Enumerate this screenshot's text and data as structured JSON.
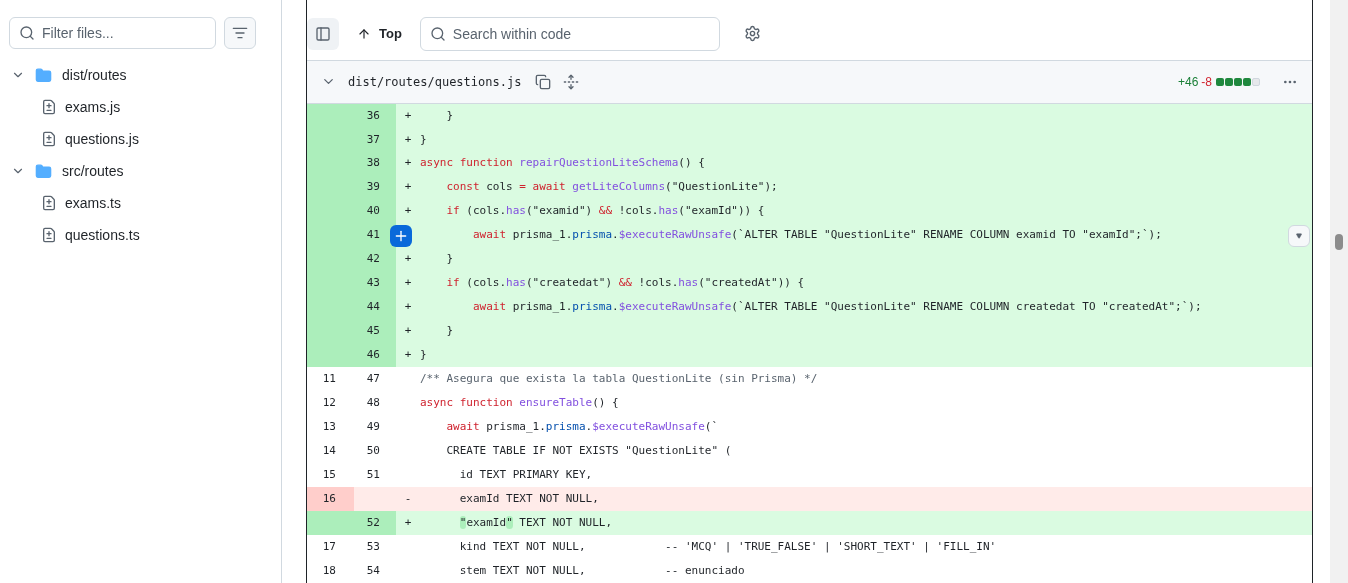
{
  "sidebar": {
    "filter": {
      "placeholder": "Filter files..."
    },
    "tree": [
      {
        "name": "dist/routes",
        "expanded": true,
        "children": [
          {
            "name": "exams.js"
          },
          {
            "name": "questions.js"
          }
        ]
      },
      {
        "name": "src/routes",
        "expanded": true,
        "children": [
          {
            "name": "exams.ts"
          },
          {
            "name": "questions.ts"
          }
        ]
      }
    ]
  },
  "toolbar": {
    "top_label": "Top",
    "search": {
      "placeholder": "Search within code"
    }
  },
  "file": {
    "path": "dist/routes/questions.js",
    "expanded": true,
    "additions": "+46",
    "deletions": "-8",
    "diffstat": [
      {
        "kind": "add"
      },
      {
        "kind": "add"
      },
      {
        "kind": "add"
      },
      {
        "kind": "add"
      },
      {
        "kind": "neutral"
      }
    ],
    "lines": [
      {
        "kind": "add",
        "new": "36",
        "marker": "+",
        "tokens": [
          {
            "kind": "plain",
            "t": "    }"
          }
        ]
      },
      {
        "kind": "add",
        "new": "37",
        "marker": "+",
        "tokens": [
          {
            "kind": "plain",
            "t": "}"
          }
        ]
      },
      {
        "kind": "add",
        "new": "38",
        "marker": "+",
        "tokens": [
          {
            "kind": "keyword",
            "t": "async function"
          },
          {
            "kind": "function",
            "t": " repairQuestionLiteSchema"
          },
          {
            "kind": "plain",
            "t": "() {"
          }
        ]
      },
      {
        "kind": "add",
        "new": "39",
        "marker": "+",
        "tokens": [
          {
            "kind": "keyword",
            "t": "    const"
          },
          {
            "kind": "plain",
            "t": " cols "
          },
          {
            "kind": "keyword",
            "t": "= await"
          },
          {
            "kind": "function",
            "t": " getLiteColumns"
          },
          {
            "kind": "plain",
            "t": "(\"QuestionLite\");"
          }
        ]
      },
      {
        "kind": "add",
        "new": "40",
        "marker": "+",
        "tokens": [
          {
            "kind": "keyword",
            "t": "    if"
          },
          {
            "kind": "plain",
            "t": " (cols."
          },
          {
            "kind": "function",
            "t": "has"
          },
          {
            "kind": "plain",
            "t": "(\"examid\") "
          },
          {
            "kind": "keyword",
            "t": "&&"
          },
          {
            "kind": "plain",
            "t": " !cols."
          },
          {
            "kind": "function",
            "t": "has"
          },
          {
            "kind": "plain",
            "t": "(\"examId\")) {"
          }
        ]
      },
      {
        "kind": "add",
        "new": "41",
        "hovered": true,
        "tokens": [
          {
            "kind": "keyword",
            "t": "        await"
          },
          {
            "kind": "plain",
            "t": " prisma_1."
          },
          {
            "kind": "property",
            "t": "prisma"
          },
          {
            "kind": "plain",
            "t": "."
          },
          {
            "kind": "function",
            "t": "$executeRawUnsafe"
          },
          {
            "kind": "plain",
            "t": "(`ALTER TABLE \"QuestionLite\" RENAME COLUMN examid TO \"examId\";`);"
          }
        ]
      },
      {
        "kind": "add",
        "new": "42",
        "marker": "+",
        "tokens": [
          {
            "kind": "plain",
            "t": "    }"
          }
        ]
      },
      {
        "kind": "add",
        "new": "43",
        "marker": "+",
        "tokens": [
          {
            "kind": "keyword",
            "t": "    if"
          },
          {
            "kind": "plain",
            "t": " (cols."
          },
          {
            "kind": "function",
            "t": "has"
          },
          {
            "kind": "plain",
            "t": "(\"createdat\") "
          },
          {
            "kind": "keyword",
            "t": "&&"
          },
          {
            "kind": "plain",
            "t": " !cols."
          },
          {
            "kind": "function",
            "t": "has"
          },
          {
            "kind": "plain",
            "t": "(\"createdAt\")) {"
          }
        ]
      },
      {
        "kind": "add",
        "new": "44",
        "marker": "+",
        "tokens": [
          {
            "kind": "keyword",
            "t": "        await"
          },
          {
            "kind": "plain",
            "t": " prisma_1."
          },
          {
            "kind": "property",
            "t": "prisma"
          },
          {
            "kind": "plain",
            "t": "."
          },
          {
            "kind": "function",
            "t": "$executeRawUnsafe"
          },
          {
            "kind": "plain",
            "t": "(`ALTER TABLE \"QuestionLite\" RENAME COLUMN createdat TO \"createdAt\";`);"
          }
        ]
      },
      {
        "kind": "add",
        "new": "45",
        "marker": "+",
        "tokens": [
          {
            "kind": "plain",
            "t": "    }"
          }
        ]
      },
      {
        "kind": "add",
        "new": "46",
        "marker": "+",
        "tokens": [
          {
            "kind": "plain",
            "t": "}"
          }
        ]
      },
      {
        "kind": "ctx",
        "old": "11",
        "new": "47",
        "tokens": [
          {
            "kind": "comment",
            "t": "/** Asegura que exista la tabla QuestionLite (sin Prisma) */"
          }
        ]
      },
      {
        "kind": "ctx",
        "old": "12",
        "new": "48",
        "tokens": [
          {
            "kind": "keyword",
            "t": "async function"
          },
          {
            "kind": "function",
            "t": " ensureTable"
          },
          {
            "kind": "plain",
            "t": "() {"
          }
        ]
      },
      {
        "kind": "ctx",
        "old": "13",
        "new": "49",
        "tokens": [
          {
            "kind": "keyword",
            "t": "    await"
          },
          {
            "kind": "plain",
            "t": " prisma_1."
          },
          {
            "kind": "property",
            "t": "prisma"
          },
          {
            "kind": "plain",
            "t": "."
          },
          {
            "kind": "function",
            "t": "$executeRawUnsafe"
          },
          {
            "kind": "plain",
            "t": "(`"
          }
        ]
      },
      {
        "kind": "ctx",
        "old": "14",
        "new": "50",
        "tokens": [
          {
            "kind": "plain",
            "t": "    CREATE TABLE IF NOT EXISTS \"QuestionLite\" ("
          }
        ]
      },
      {
        "kind": "ctx",
        "old": "15",
        "new": "51",
        "tokens": [
          {
            "kind": "plain",
            "t": "      id TEXT PRIMARY KEY,"
          }
        ]
      },
      {
        "kind": "del",
        "old": "16",
        "marker": "-",
        "tokens": [
          {
            "kind": "plain",
            "t": "      examId TEXT NOT NULL,"
          }
        ]
      },
      {
        "kind": "add",
        "new": "52",
        "marker": "+",
        "tokens": [
          {
            "kind": "highlight",
            "t": "      \""
          },
          {
            "kind": "plain",
            "t": "examId"
          },
          {
            "kind": "highlight",
            "t": "\""
          },
          {
            "kind": "plain",
            "t": " TEXT NOT NULL,"
          }
        ]
      },
      {
        "kind": "ctx",
        "old": "17",
        "new": "53",
        "tokens": [
          {
            "kind": "plain",
            "t": "      kind TEXT NOT NULL,            -- 'MCQ' | 'TRUE_FALSE' | 'SHORT_TEXT' | 'FILL_IN'"
          }
        ]
      },
      {
        "kind": "ctx",
        "old": "18",
        "new": "54",
        "tokens": [
          {
            "kind": "plain",
            "t": "      stem TEXT NOT NULL,            -- enunciado"
          }
        ]
      }
    ]
  }
}
